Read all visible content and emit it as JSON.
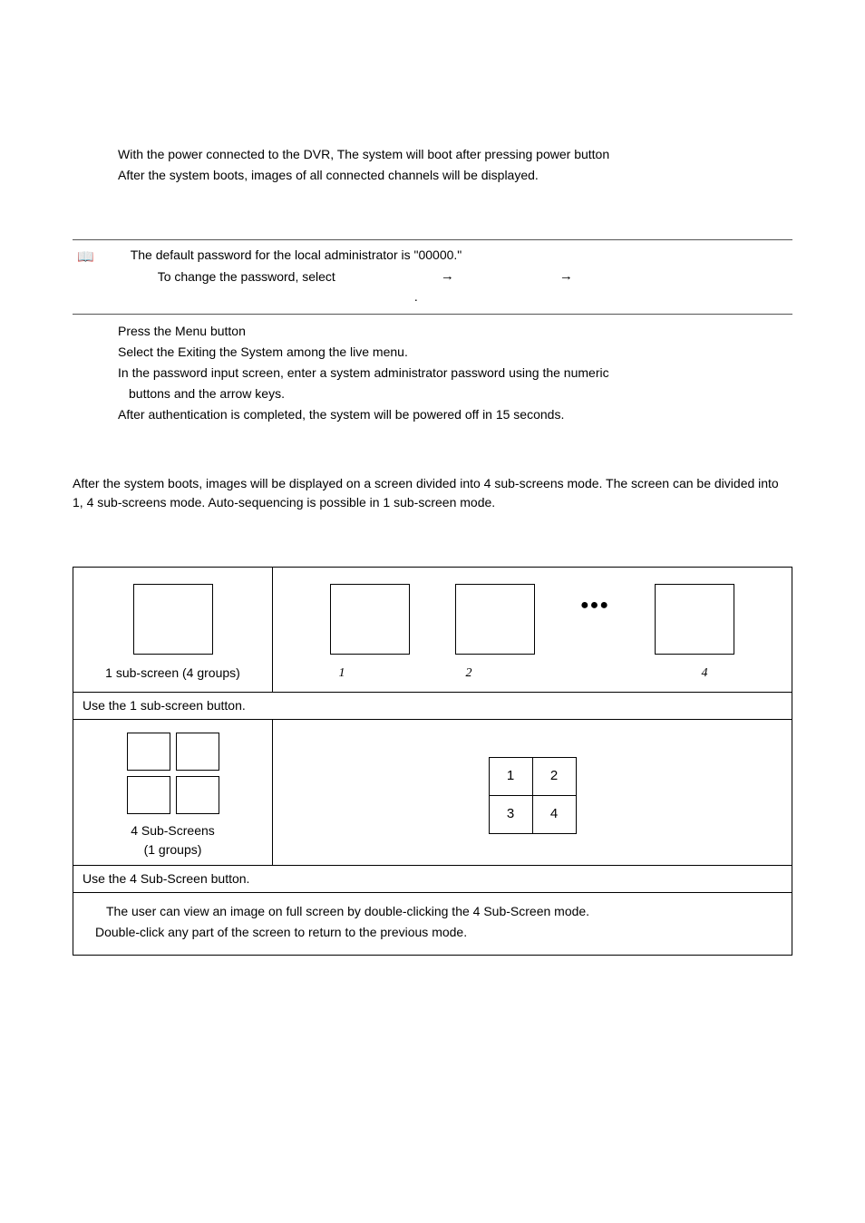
{
  "intro": {
    "line1": "With the power connected to the DVR, The system will boot after pressing power button",
    "line2": "After the system boots, images of all connected channels will be displayed."
  },
  "infobox": {
    "icon": "📖",
    "line1": "The default password for the local administrator is \"00000.\"",
    "line2a": "To  change  the  password,  select",
    "arrow": "→",
    "dot": "."
  },
  "steps": {
    "s1": "Press the Menu button",
    "s2": "Select the Exiting the System among the live menu.",
    "s3": "In the password input screen, enter a system administrator  password using the numeric",
    "s3b": "buttons and the arrow keys.",
    "s4": "After authentication is completed, the system will be powered off in 15 seconds."
  },
  "desc": "After the system boots, images will be displayed on a screen divided into 4 sub-screens mode. The screen can be divided into 1, 4 sub-screens mode. Auto-sequencing is possible in 1 sub-screen mode.",
  "figure": {
    "row1_left_label": "1 sub-screen (4 groups)",
    "row1_nums": {
      "n1": "1",
      "n2": "2",
      "n4": "4"
    },
    "dots": "●●●",
    "row1_label": "Use the 1 sub-screen button.",
    "row2_left_label_a": "4 Sub-Screens",
    "row2_left_label_b": "(1 groups)",
    "grid": {
      "c1": "1",
      "c2": "2",
      "c3": "3",
      "c4": "4"
    },
    "row2_label": "Use the 4 Sub-Screen button.",
    "note1": "The user can view an image on full screen by double-clicking the 4 Sub-Screen mode.",
    "note2": "Double-click any part of the screen to return to the previous mode."
  }
}
